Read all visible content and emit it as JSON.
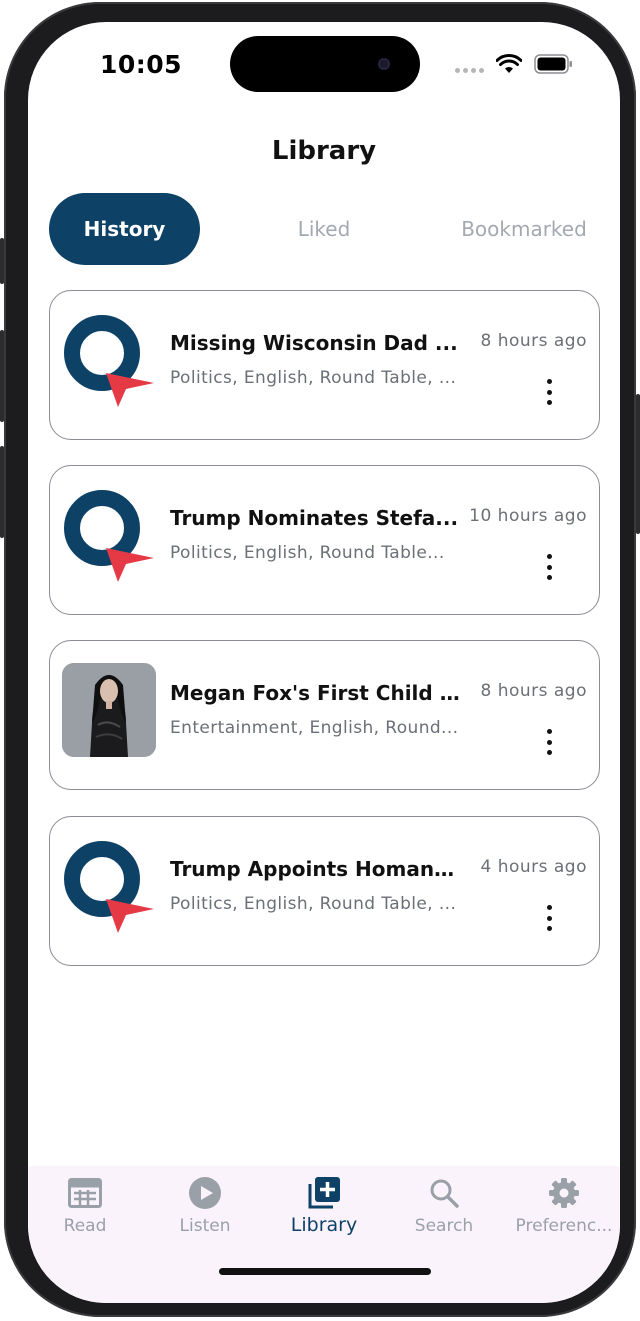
{
  "status_bar": {
    "time": "10:05"
  },
  "header": {
    "title": "Library"
  },
  "tabs": [
    {
      "label": "History",
      "active": true
    },
    {
      "label": "Liked",
      "active": false
    },
    {
      "label": "Bookmarked",
      "active": false
    }
  ],
  "history": [
    {
      "title": "Missing Wisconsin Dad ...",
      "time": "8 hours ago",
      "tags": "Politics, English, Round Table, ...",
      "thumb": "logo-icon"
    },
    {
      "title": "Trump Nominates Stefa...",
      "time": "10 hours ago",
      "tags": "Politics, English, Round Table...",
      "thumb": "logo-icon"
    },
    {
      "title": "Megan Fox's First Child ...",
      "time": "8 hours ago",
      "tags": "Entertainment, English, Round...",
      "thumb": "photo"
    },
    {
      "title": "Trump Appoints Homan ...",
      "time": "4 hours ago",
      "tags": "Politics, English, Round Table, ...",
      "thumb": "logo-icon"
    }
  ],
  "bottom_nav": [
    {
      "label": "Read",
      "icon": "newspaper-icon",
      "active": false
    },
    {
      "label": "Listen",
      "icon": "play-circle-icon",
      "active": false
    },
    {
      "label": "Library",
      "icon": "library-add-icon",
      "active": true
    },
    {
      "label": "Search",
      "icon": "search-icon",
      "active": false
    },
    {
      "label": "Preferenc...",
      "icon": "gear-icon",
      "active": false
    }
  ],
  "colors": {
    "accent": "#0d4166",
    "logo_navy": "#0d4166",
    "logo_red": "#e63946",
    "muted_text": "#6b6f76",
    "nav_background": "#fbf3fb"
  }
}
